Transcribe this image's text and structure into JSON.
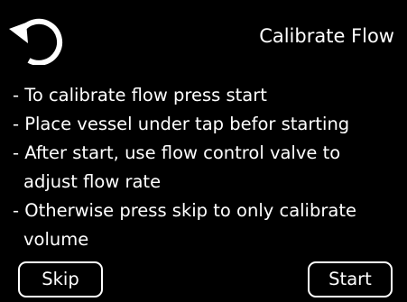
{
  "header": {
    "back_icon": "rotate-back-icon",
    "title": "Calibrate Flow"
  },
  "instructions": [
    "- To calibrate flow press start",
    "- Place vessel under tap befor starting",
    "- After start, use flow control valve to",
    "adjust flow rate",
    "- Otherwise press skip to only calibrate",
    "volume"
  ],
  "buttons": {
    "skip_label": "Skip",
    "start_label": "Start"
  },
  "colors": {
    "background": "#000000",
    "foreground": "#ffffff"
  }
}
